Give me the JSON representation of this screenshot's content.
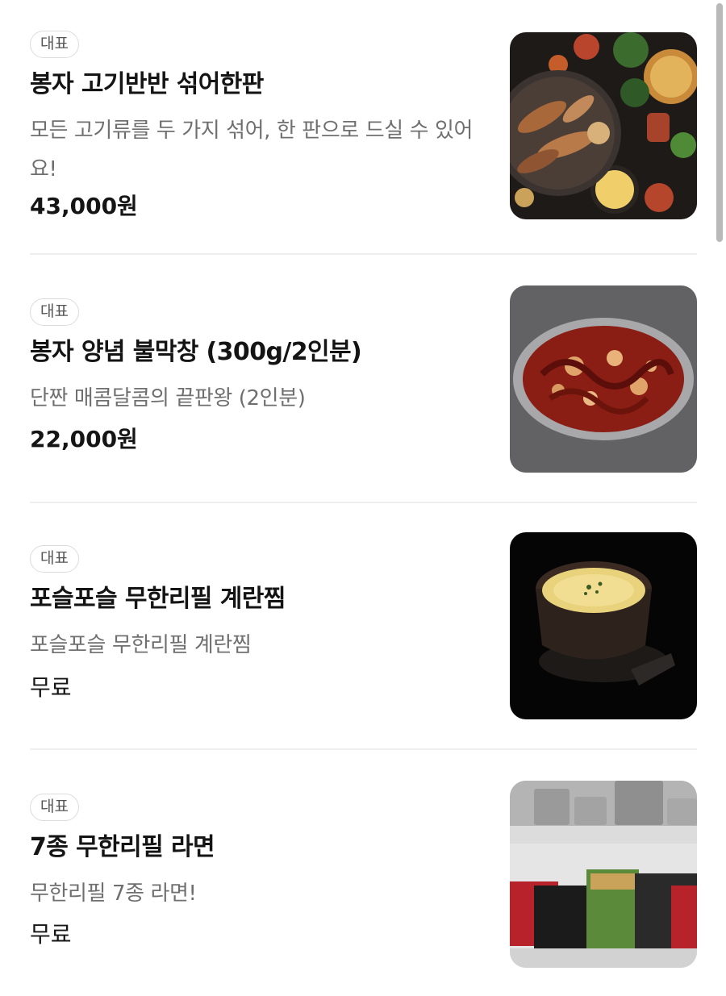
{
  "menu": {
    "items": [
      {
        "badge": "대표",
        "name": "봉자 고기반반 섞어한판",
        "description": "모든 고기류를 두 가지 섞어, 한 판으로 드실 수 있어요!",
        "price": "43,000원",
        "image_alt": "grilled meat platter with side dishes"
      },
      {
        "badge": "대표",
        "name": "봉자 양념 불막창 (300g/2인분)",
        "description": "단짠 매콤달콤의 끝판왕 (2인분)",
        "price": "22,000원",
        "image_alt": "spicy marinated makchang on metal plate"
      },
      {
        "badge": "대표",
        "name": "포슬포슬 무한리필 계란찜",
        "description": "포슬포슬 무한리필 계란찜",
        "price": "무료",
        "image_alt": "steamed egg in earthen pot"
      },
      {
        "badge": "대표",
        "name": "7종 무한리필 라면",
        "description": "무한리필 7종 라면!",
        "price": "무료",
        "image_alt": "shelves of ramen packs and pots"
      }
    ]
  },
  "colors": {
    "text_primary": "#141414",
    "text_secondary": "#6f6f6f",
    "badge_border": "#dcdcdc",
    "divider": "#eeeeee",
    "scrollbar": "#b9b9b9"
  }
}
